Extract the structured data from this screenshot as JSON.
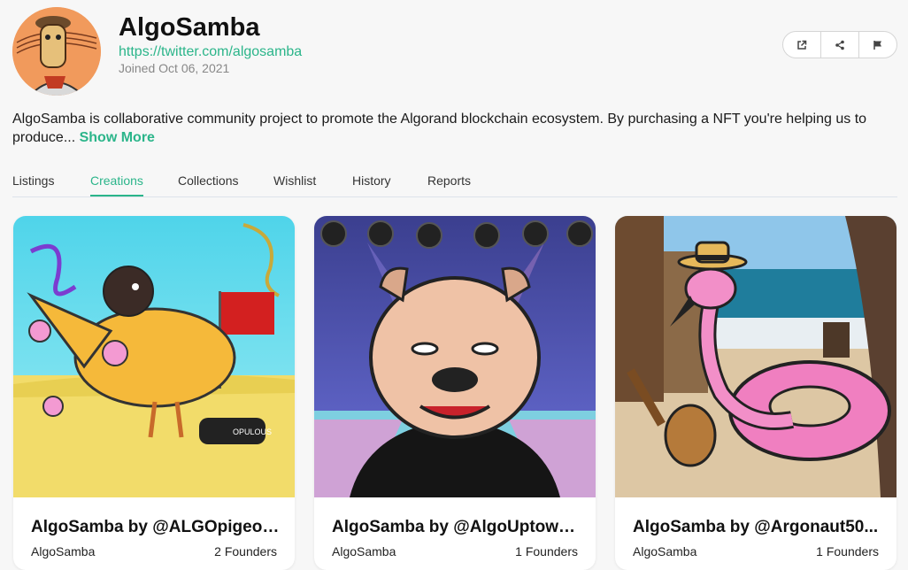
{
  "profile": {
    "name": "AlgoSamba",
    "link": "https://twitter.com/algosamba",
    "joined": "Joined Oct 06, 2021",
    "description": "AlgoSamba is collaborative community project to promote the Algorand blockchain ecosystem. By purchasing a NFT you're helping us to produce...",
    "show_more": "Show More"
  },
  "actions": [
    {
      "icon": "external-link-icon"
    },
    {
      "icon": "share-icon"
    },
    {
      "icon": "flag-icon"
    }
  ],
  "tabs": [
    {
      "label": "Listings"
    },
    {
      "label": "Creations",
      "active": true
    },
    {
      "label": "Collections"
    },
    {
      "label": "Wishlist"
    },
    {
      "label": "History"
    },
    {
      "label": "Reports"
    }
  ],
  "cards": [
    {
      "name": "AlgoSamba by @ALGOpigeons",
      "creator": "AlgoSamba",
      "founders": "2 Founders",
      "watermark": "OPULOUS"
    },
    {
      "name": "AlgoSamba by @AlgoUptown...",
      "creator": "AlgoSamba",
      "founders": "1 Founders"
    },
    {
      "name": "AlgoSamba by @Argonaut50...",
      "creator": "AlgoSamba",
      "founders": "1 Founders"
    }
  ],
  "colors": {
    "accent": "#2bb58a",
    "background": "#f7f7f7"
  }
}
